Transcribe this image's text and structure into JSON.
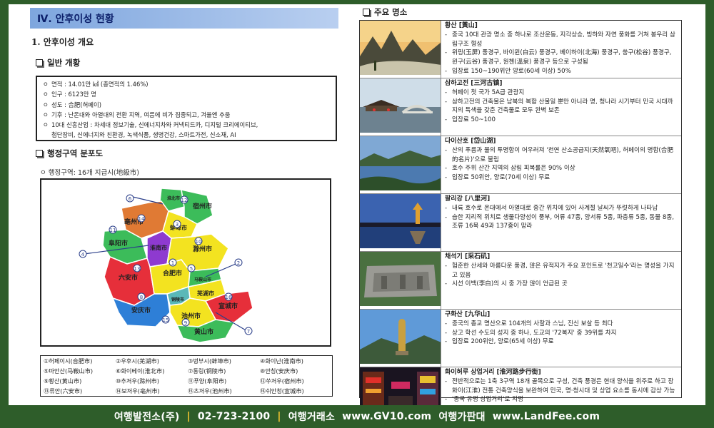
{
  "section_title": "Ⅳ. 안후이성 현황",
  "heading": "1. 안후이성 개요",
  "general": {
    "title": "일반 개황",
    "items": [
      "면적 : 14.01만 ㎢ (총면적의 1.46%)",
      "인구 : 6123만 명",
      "성도 : 合肥(허페이)",
      "기후 : 난온대와 아열대의 전환 지역, 여름에 비가 집중되고, 겨울엔 추움",
      "10대 신흥산업 : 차세대 정보기술, 신에너지차와 커넥티드카, 디지털 크리에이티브,",
      "첨단장비, 신에너지와 친환경, 녹색식품, 생명건강, 스마트가전, 신소재, AI"
    ],
    "item_markers": [
      "ㅇ",
      "ㅇ",
      "ㅇ",
      "ㅇ",
      "ㅇ",
      ""
    ]
  },
  "admin": {
    "title": "행정구역 분포도",
    "subtitle": "ㅇ 행정구역: 16개 지급시(地級市)"
  },
  "map": {
    "labels": [
      "宿州市",
      "淮北市",
      "亳州市",
      "蚌埠市",
      "阜阳市",
      "淮南市",
      "滁州市",
      "六安市",
      "合肥市",
      "马鞍山市",
      "芜湖市",
      "安庆市",
      "铜陵市",
      "宣城市",
      "池州市",
      "黄山市"
    ],
    "numbers": [
      "1",
      "2",
      "3",
      "4",
      "5",
      "6",
      "7",
      "8",
      "9",
      "10",
      "11",
      "12",
      "13",
      "14",
      "15",
      "16"
    ],
    "colors": {
      "green": "#3cbc5a",
      "yellow": "#f3e320",
      "orange": "#e07a34",
      "purple": "#8e3ad0",
      "red": "#e62f3a",
      "blue": "#2e7fd7",
      "teal": "#5ab8b8",
      "pink": "#d25fc8"
    }
  },
  "legend": [
    "①허페이시(合肥市)",
    "②우후시(芜湖市)",
    "③벙부시(蚌埠市)",
    "④화이난(淮南市)",
    "⑤마안산(马鞍山市)",
    "⑥화이베이(淮北市)",
    "⑦통링(铜陵市)",
    "⑧안칭(安庆市)",
    "⑨황산(黄山市)",
    "⑩추저우(滁州市)",
    "⑪푸양(阜阳市)",
    "⑫쑤저우(宿州市)",
    "⑬류안(六安市)",
    "⑭보저우(亳州市)",
    "⑮츠저우(池州市)",
    "⑯쉬안청(宣城市)"
  ],
  "attractions": {
    "title": "주요 명소",
    "items": [
      {
        "name": "황산 [黃山]",
        "icon": "mountain-photo-icon",
        "lines": [
          "중국 10대 관광 명소 중 하나로 조산운동, 지각상승, 빙하와 자연 풍화를 거쳐 봉우리 삼림구조 형성",
          "위핑(玉屏) 풍경구, 바이윈(白云) 풍경구, 베이하이(北海) 풍경구, 쑹구(松谷) 풍경구, 윈구(云谷) 풍경구, 원첸(溫泉) 풍경구 등으로 구성됨",
          "입장료 150~190위안 양로(60세 이상) 50%"
        ]
      },
      {
        "name": "삼하고전 [三河古镇]",
        "icon": "bridge-photo-icon",
        "lines": [
          "허페이 첫 국가 5A급 관광지",
          "삼하고전의 건축물은 남북의 복합 산물일 뿐만 아니라 명, 청나라 시기부터 민국 시대까지의 특색을 갖춘 건축물로 모두 완벽 보존",
          "입장료 50~100"
        ]
      },
      {
        "name": "다이산호 [岱山湖]",
        "icon": "lake-photo-icon",
        "lines": [
          "산의 푸름과 물의 투명함이 어우러져 '천연 산소공급지(天然氧吧), 허페이의 명함(合肥的名片)'으로 불림",
          "호수 주위 산간 지역의 삼림 피복률은 90% 이상",
          "입장료 50위안, 양로(70세 이상) 무료"
        ]
      },
      {
        "name": "팔리강 [八里河]",
        "icon": "river-photo-icon",
        "lines": [
          "내륙 호수로 온대에서 아열대로 중간 위치에 있어 사계절 날씨가 뚜렷하게 나타남",
          "습한 지리적 위치로 생물다양성이 풍부, 어류 47종, 양서류 5종, 파충류 5종, 동물 8종, 조류 16목 49과 137종이 망라"
        ]
      },
      {
        "name": "채석기 [采石矶]",
        "icon": "cliff-photo-icon",
        "lines": [
          "험준한 산세와 아름다운 풍경, 많은 유적지가 주요 포인트로 '천고일수'라는 명성을 가지고 있음",
          "시선 이백(李白)의 시 중 가장 많이 언급된 곳"
        ]
      },
      {
        "name": "구화산 [九华山]",
        "icon": "statue-photo-icon",
        "lines": [
          "중국의 종교 명산으로 104개의 사찰과 스님, 진신 보살 등 최다",
          "상고 학선 수도의 성지 중 하나, 도교의 '72복지' 중 39위를 차지",
          "입장료 200위안, 양로(65세 이상) 무료"
        ]
      },
      {
        "name": "화이허루 상업거리 [淮河路步行街]",
        "icon": "street-photo-icon",
        "lines": [
          "전반적으로는 1축 3구역 18개 골목으로 구성, 건축 풍경은 현대 양식을 위주로 하고 장화이(江淮) 전통 건축양식을 보완하여 민국, 명·청시대 및 상업 요소를 동시에 감상 가능",
          "'중국 유명 상업거리'로 지명"
        ]
      }
    ]
  },
  "footer": {
    "company": "여행발전소(주)",
    "phone": "02-723-2100",
    "agency": "여행거래소",
    "site1": "www.GV10.com",
    "market": "여행가판대",
    "site2": "www.LandFee.com",
    "sep": "|"
  }
}
